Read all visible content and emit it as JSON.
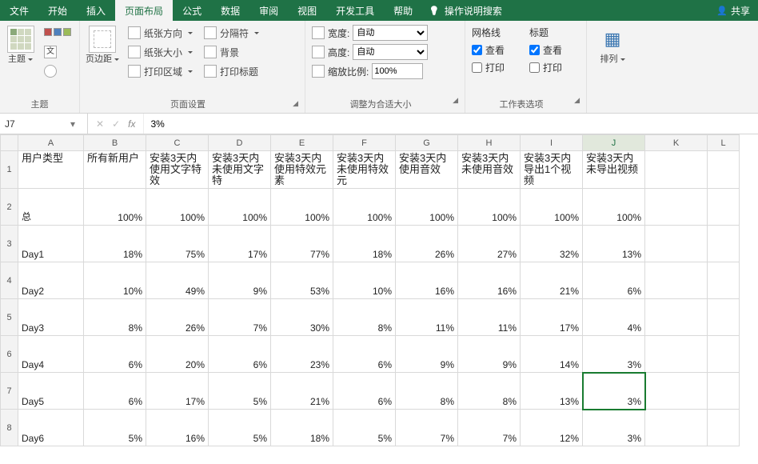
{
  "menu": {
    "tabs": [
      "文件",
      "开始",
      "插入",
      "页面布局",
      "公式",
      "数据",
      "审阅",
      "视图",
      "开发工具",
      "帮助"
    ],
    "active_index": 3,
    "tell_me": "操作说明搜索",
    "share": "共享"
  },
  "ribbon": {
    "themes": {
      "title": "主题",
      "theme": "主题",
      "colorsRow": [
        "颜色",
        "字体",
        "效果"
      ]
    },
    "pagesetup": {
      "title": "页面设置",
      "margins": "页边距",
      "items": [
        "纸张方向",
        "纸张大小",
        "打印区域",
        "分隔符",
        "背景",
        "打印标题"
      ]
    },
    "scale": {
      "title": "调整为合适大小",
      "width_lbl": "宽度:",
      "height_lbl": "高度:",
      "auto": "自动",
      "scale_lbl": "缩放比例:",
      "scale_val": "100%"
    },
    "sheetopts": {
      "title": "工作表选项",
      "grid": "网格线",
      "heading": "标题",
      "view": "查看",
      "print": "打印",
      "grid_view": true,
      "grid_print": false,
      "head_view": true,
      "head_print": false
    },
    "arrange": {
      "title": "排列",
      "label": "排列"
    }
  },
  "fbar": {
    "name": "J7",
    "formula": "3%"
  },
  "sheet": {
    "columns": [
      "A",
      "B",
      "C",
      "D",
      "E",
      "F",
      "G",
      "H",
      "I",
      "J",
      "K",
      "L"
    ],
    "rows": [
      {
        "n": 1,
        "cells": [
          "用户类型",
          "所有新用户",
          "安装3天内使用文字特效",
          "安装3天内未使用文字特",
          "安装3天内使用特效元素",
          "安装3天内未使用特效元",
          "安装3天内使用音效",
          "安装3天内未使用音效",
          "安装3天内导出1个视频",
          "安装3天内未导出视频",
          "",
          ""
        ]
      },
      {
        "n": 2,
        "cells": [
          "总",
          "100%",
          "100%",
          "100%",
          "100%",
          "100%",
          "100%",
          "100%",
          "100%",
          "100%",
          "",
          ""
        ]
      },
      {
        "n": 3,
        "cells": [
          "Day1",
          "18%",
          "75%",
          "17%",
          "77%",
          "18%",
          "26%",
          "27%",
          "32%",
          "13%",
          "",
          ""
        ]
      },
      {
        "n": 4,
        "cells": [
          "Day2",
          "10%",
          "49%",
          "9%",
          "53%",
          "10%",
          "16%",
          "16%",
          "21%",
          "6%",
          "",
          ""
        ]
      },
      {
        "n": 5,
        "cells": [
          "Day3",
          "8%",
          "26%",
          "7%",
          "30%",
          "8%",
          "11%",
          "11%",
          "17%",
          "4%",
          "",
          ""
        ]
      },
      {
        "n": 6,
        "cells": [
          "Day4",
          "6%",
          "20%",
          "6%",
          "23%",
          "6%",
          "9%",
          "9%",
          "14%",
          "3%",
          "",
          ""
        ]
      },
      {
        "n": 7,
        "cells": [
          "Day5",
          "6%",
          "17%",
          "5%",
          "21%",
          "6%",
          "8%",
          "8%",
          "13%",
          "3%",
          "",
          ""
        ]
      },
      {
        "n": 8,
        "cells": [
          "Day6",
          "5%",
          "16%",
          "5%",
          "18%",
          "5%",
          "7%",
          "7%",
          "12%",
          "3%",
          "",
          ""
        ]
      }
    ],
    "selected": {
      "row": 7,
      "col": "J"
    }
  }
}
